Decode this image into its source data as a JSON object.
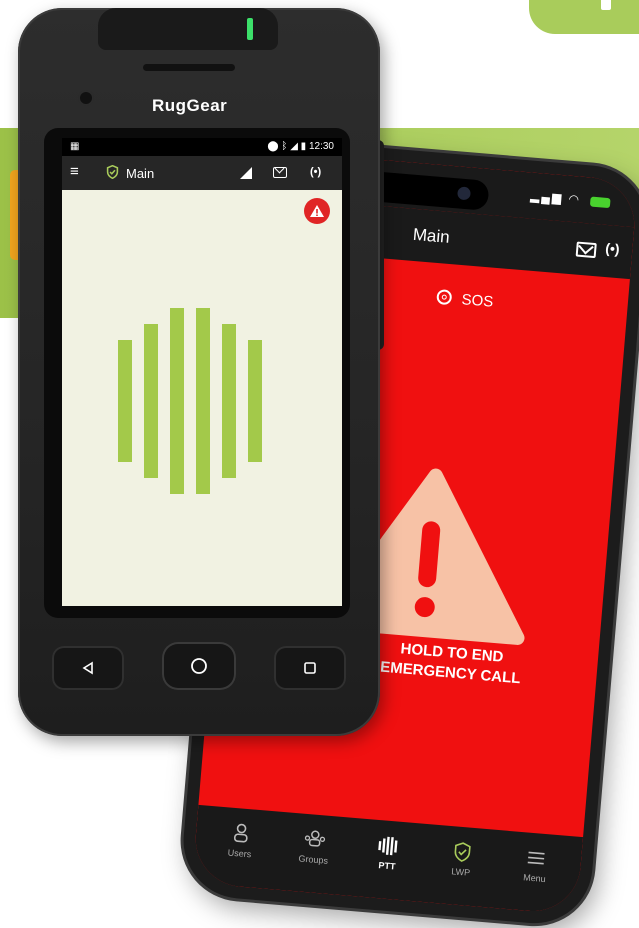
{
  "colors": {
    "brand_green": "#a9cc5b",
    "ptt_bar_green": "#a3c94a",
    "sos_red": "#f01010",
    "alert_red": "#e02525",
    "screen_bg": "#f1f2e2",
    "warning_triangle": "#f7c2a6"
  },
  "rugged_phone": {
    "brand": "RugGear",
    "status_bar": {
      "time": "12:30",
      "icons": [
        "location-icon",
        "bluetooth-icon",
        "signal-icon",
        "battery-icon"
      ]
    },
    "app_bar": {
      "menu_icon": "hamburger-icon",
      "channel_icon": "shield-check-icon",
      "title": "Main",
      "icons": [
        "signal-icon",
        "mail-icon",
        "broadcast-icon"
      ]
    },
    "alert_icon": "warning-icon",
    "ptt_icon": "ptt-bars-icon",
    "nav_keys": [
      "back-icon",
      "home-icon",
      "recents-icon"
    ]
  },
  "iphone": {
    "header": {
      "title": "Main",
      "icons": [
        "mail-icon",
        "broadcast-icon"
      ]
    },
    "sos_label": "SOS",
    "warning_icon": "warning-triangle-icon",
    "hold_text_line1": "HOLD TO END",
    "hold_text_line2": "EMERGENCY CALL",
    "tabs": [
      {
        "label": "Users",
        "icon": "user-icon",
        "active": false
      },
      {
        "label": "Groups",
        "icon": "groups-icon",
        "active": false
      },
      {
        "label": "PTT",
        "icon": "ptt-icon",
        "active": true
      },
      {
        "label": "LWP",
        "icon": "shield-check-icon",
        "active": false
      },
      {
        "label": "Menu",
        "icon": "menu-icon",
        "active": false
      }
    ]
  }
}
